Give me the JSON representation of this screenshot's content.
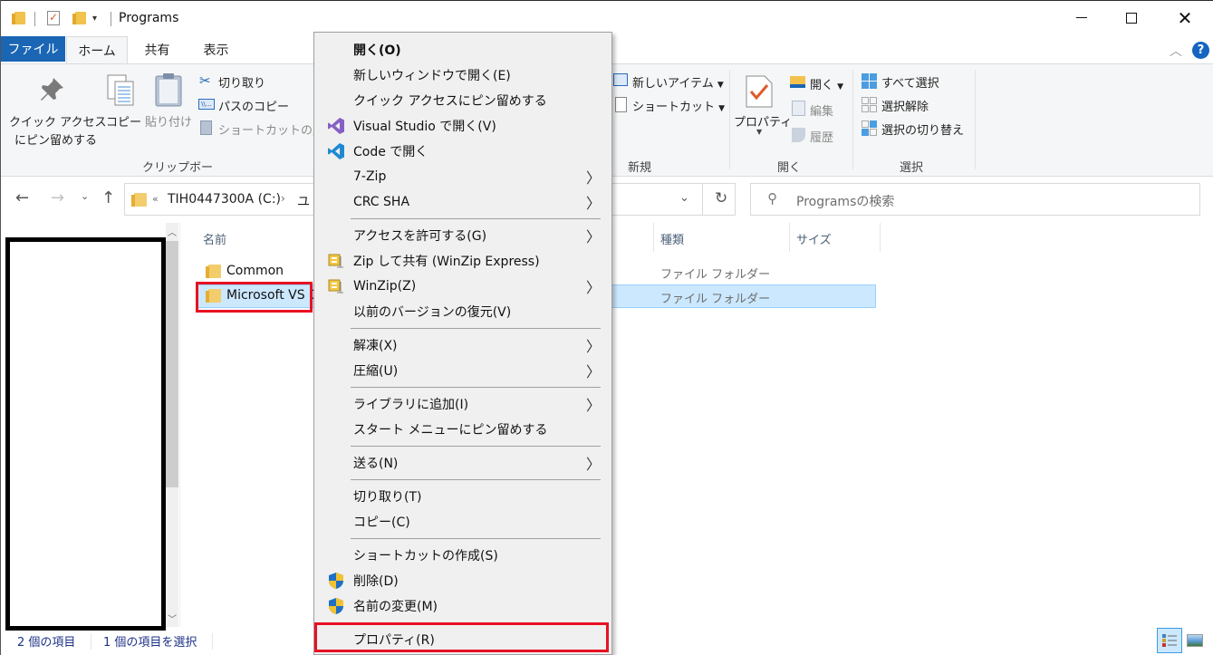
{
  "window": {
    "title": "Programs",
    "controls": {
      "minimize": "minimize",
      "maximize": "maximize",
      "close": "close"
    }
  },
  "ribbon_tabs": [
    {
      "label": "ファイル",
      "active": false
    },
    {
      "label": "ホーム",
      "active": true
    },
    {
      "label": "共有",
      "active": false
    },
    {
      "label": "表示",
      "active": false
    }
  ],
  "ribbon": {
    "clipboard": {
      "pin_quick_access_line1": "クイック アクセス",
      "pin_quick_access_line2": "にピン留めする",
      "copy": "コピー",
      "paste": "貼り付け",
      "cut": "切り取り",
      "copy_path": "パスのコピー",
      "paste_shortcut": "ショートカットの貼り",
      "group_label": "クリップボード"
    },
    "new": {
      "new_item": "新しいアイテム",
      "shortcut": "ショートカット",
      "group_label": "新規"
    },
    "open": {
      "properties": "プロパティ",
      "open": "開く",
      "edit": "編集",
      "history": "履歴",
      "group_label": "開く"
    },
    "select": {
      "select_all": "すべて選択",
      "select_none": "選択解除",
      "invert_selection": "選択の切り替え",
      "group_label": "選択"
    }
  },
  "navigation": {
    "address": {
      "chevron": "«",
      "drive": "TIH0447300A (C:)",
      "next_segment": "ユ"
    },
    "search_placeholder": "Programsの検索"
  },
  "file_list": {
    "columns": [
      "名前",
      "種類",
      "サイズ"
    ],
    "rows": [
      {
        "name": "Common",
        "type": "ファイル フォルダー",
        "selected": false
      },
      {
        "name": "Microsoft VS C",
        "type": "ファイル フォルダー",
        "selected": true
      }
    ]
  },
  "status_bar": {
    "item_count": "2 個の項目",
    "selected_count": "1 個の項目を選択"
  },
  "context_menu": {
    "items": [
      {
        "label": "開く(O)",
        "bold": true,
        "icon": null,
        "submenu": false
      },
      {
        "label": "新しいウィンドウで開く(E)",
        "icon": null,
        "submenu": false
      },
      {
        "label": "クイック アクセスにピン留めする",
        "icon": null,
        "submenu": false
      },
      {
        "label": "Visual Studio で開く(V)",
        "icon": "visual-studio-icon",
        "submenu": false
      },
      {
        "label": "Code で開く",
        "icon": "vscode-icon",
        "submenu": false
      },
      {
        "label": "7-Zip",
        "icon": null,
        "submenu": true
      },
      {
        "label": "CRC SHA",
        "icon": null,
        "submenu": true
      },
      {
        "label": "アクセスを許可する(G)",
        "icon": null,
        "submenu": true
      },
      {
        "label": "Zip して共有 (WinZip Express)",
        "icon": "winzip-icon",
        "submenu": false
      },
      {
        "label": "WinZip(Z)",
        "icon": "winzip-icon",
        "submenu": true
      },
      {
        "label": "以前のバージョンの復元(V)",
        "icon": null,
        "submenu": false
      },
      {
        "label": "解凍(X)",
        "icon": null,
        "submenu": true
      },
      {
        "label": "圧縮(U)",
        "icon": null,
        "submenu": true
      },
      {
        "label": "ライブラリに追加(I)",
        "icon": null,
        "submenu": true
      },
      {
        "label": "スタート メニューにピン留めする",
        "icon": null,
        "submenu": false
      },
      {
        "label": "送る(N)",
        "icon": null,
        "submenu": true
      },
      {
        "label": "切り取り(T)",
        "icon": null,
        "submenu": false
      },
      {
        "label": "コピー(C)",
        "icon": null,
        "submenu": false
      },
      {
        "label": "ショートカットの作成(S)",
        "icon": null,
        "submenu": false
      },
      {
        "label": "削除(D)",
        "icon": "uac-shield-icon",
        "submenu": false
      },
      {
        "label": "名前の変更(M)",
        "icon": "uac-shield-icon",
        "submenu": false
      },
      {
        "label": "プロパティ(R)",
        "icon": null,
        "submenu": false,
        "highlighted_annotation": true
      }
    ]
  },
  "colors": {
    "file_tab": "#1a66b5",
    "selection_bg": "#cce8ff",
    "selection_border": "#99d1ff",
    "annotation_red": "#e81123",
    "menu_bg": "#f0f0f0"
  }
}
